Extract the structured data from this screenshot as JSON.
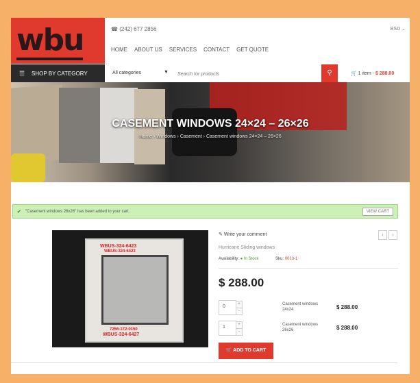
{
  "header": {
    "logo_text": "wbu",
    "phone": "(242) 677 2856",
    "currency": "BSD",
    "nav": [
      "HOME",
      "ABOUT US",
      "SERVICES",
      "CONTACT",
      "GET QUOTE"
    ]
  },
  "catbar": {
    "label": "SHOP BY CATEGORY",
    "icon": "menu-icon"
  },
  "search": {
    "category": "All categories",
    "placeholder": "Search for products",
    "button_icon": "search-icon"
  },
  "cart": {
    "summary": "1 item -",
    "total": "$ 288.00"
  },
  "hero": {
    "title": "CASEMENT WINDOWS 24×24 – 26×26",
    "breadcrumb": [
      "Home",
      "Windows",
      "Casement",
      "Casement windows 24×24 – 26×26"
    ]
  },
  "notice": {
    "message": "\"Casement windows 26x26\" has been added to your cart.",
    "button": "VIEW CART"
  },
  "product": {
    "write_comment": "Write your comment",
    "subtitle": "Hurricane Sliding windows",
    "availability_label": "Availability:",
    "availability_value": "In Stock",
    "sku_label": "Sku:",
    "sku_value": "0013-1",
    "price": "$ 288.00",
    "variants": [
      {
        "qty": "0",
        "name": "Casement windows 24x24",
        "price": "$ 288.00"
      },
      {
        "qty": "1",
        "name": "Casement windows 26x26",
        "price": "$ 288.00"
      }
    ],
    "add_to_cart": "ADD TO CART",
    "image_texts": [
      "WBUS-324-6423",
      "WBUS-324-6427",
      "7256-172-0150",
      "WBUS-324-6423"
    ]
  },
  "colors": {
    "accent": "#e03a2f",
    "frame_bg": "#f6b067",
    "notice_bg": "#cdf0b7"
  }
}
